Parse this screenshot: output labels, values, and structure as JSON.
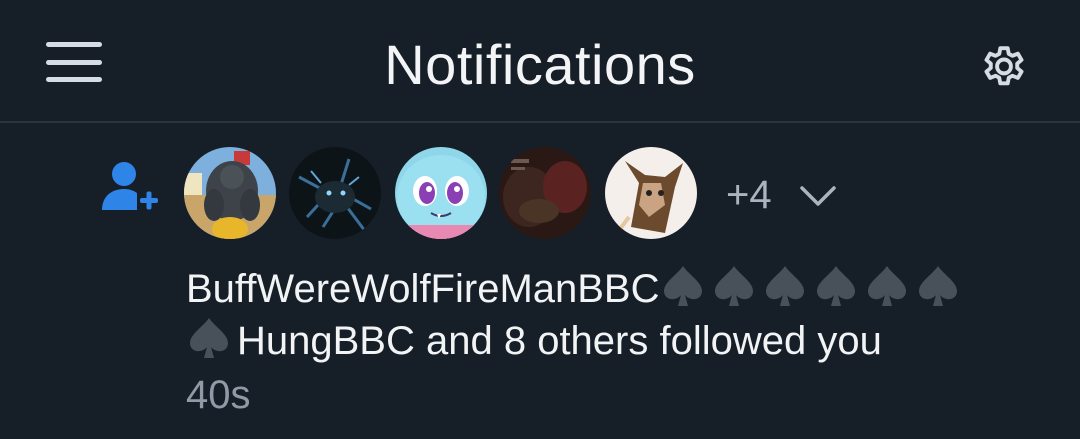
{
  "header": {
    "title": "Notifications",
    "menu_icon": "hamburger-menu-icon",
    "settings_icon": "gear-icon"
  },
  "notification": {
    "type_icon": "user-plus-icon",
    "avatars": [
      {
        "name": "avatar-1",
        "desc": "muscular wolf character"
      },
      {
        "name": "avatar-2",
        "desc": "dark wolf with blue lightning"
      },
      {
        "name": "avatar-3",
        "desc": "cyan cartoon creature with purple eyes"
      },
      {
        "name": "avatar-4",
        "desc": "dark reddish scene"
      },
      {
        "name": "avatar-5",
        "desc": "brown canine character sketch"
      }
    ],
    "more_count": "+4",
    "expand_icon": "chevron-down-icon",
    "actor_name": "BuffWereWolfFireManBBC",
    "actor_emoji": "spade-icon",
    "actor_emoji_count": 7,
    "message_rest": "HungBBC and 8 others followed you",
    "time": "40s"
  },
  "colors": {
    "background": "#161e27",
    "divider": "#2a3440",
    "accent": "#2f84e8",
    "text_primary": "#f1f3f5",
    "text_secondary": "#8f9aa6",
    "spade": "#48505a"
  }
}
